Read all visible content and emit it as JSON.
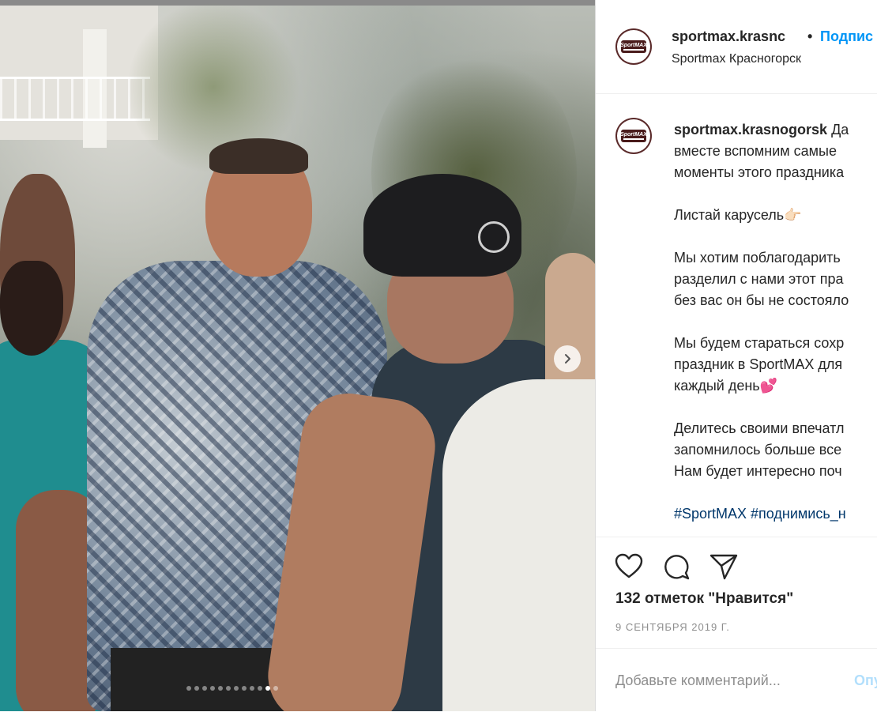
{
  "post": {
    "username": "sportmax.krasnogorsk",
    "header_username": "sportmax.krasnc",
    "separator": "•",
    "follow_label": "Подпис",
    "location": "Sportmax Красногорск",
    "avatar_logo_text": "SportMAX",
    "caption": {
      "username": "sportmax.krasnogorsk",
      "lines": [
        "Да",
        "вместе вспомним самые",
        "моменты этого праздника"
      ],
      "p2": "Листай карусель👉🏻",
      "p3": [
        "Мы хотим поблагодарить",
        "разделил с нами этот пра",
        "без вас он бы не состояло"
      ],
      "p4": [
        "Мы будем стараться сохр",
        "праздник в SportMAX для",
        "каждый день💕"
      ],
      "p5": [
        "Делитесь своими впечатл",
        "запомнилось больше все",
        "Нам будет интересно поч"
      ],
      "hashtags": "#SportMAX #поднимись_н"
    },
    "likes_text": "132 отметок \"Нравится\"",
    "date_text": "9 СЕНТЯБРЯ 2019 Г.",
    "comment_placeholder": "Добавьте комментарий...",
    "comment_post_label": "Опу"
  },
  "carousel": {
    "dot_count": 12,
    "active_index": 10
  },
  "icons": {
    "like": "heart-icon",
    "comment": "comment-icon",
    "share": "share-icon",
    "next": "chevron-right-icon"
  },
  "colors": {
    "link_blue": "#0095f6",
    "hashtag": "#00376b",
    "muted": "#8e8e8e",
    "post_disabled": "#b2dffc"
  }
}
